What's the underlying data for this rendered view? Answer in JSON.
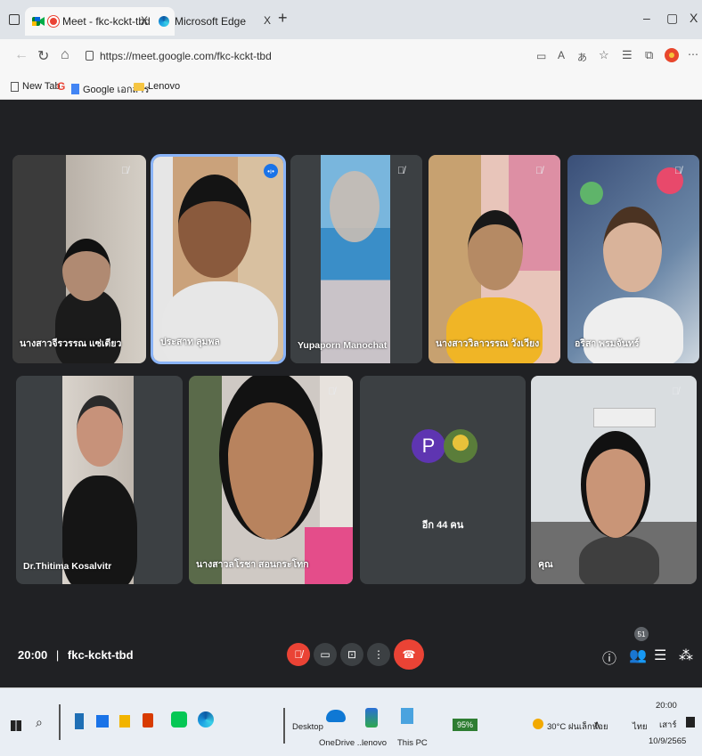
{
  "browser": {
    "tabs": [
      {
        "label": "Meet - fkc-kckt-tbd",
        "close": "X"
      },
      {
        "label": "Microsoft Edge",
        "close": "X"
      }
    ],
    "new_tab": "+",
    "url": "https://meet.google.com/fkc-kckt-tbd",
    "window_controls": {
      "minimize": "–",
      "restore": "▢",
      "close": "X"
    },
    "bookmarks": [
      "New Tab",
      "Google เอกสาร",
      "Lenovo"
    ]
  },
  "tiles": [
    {
      "name": "นางสาวจีรวรรณ แซ่เตียว",
      "muted": true
    },
    {
      "name": "ประสาท ลุมพล",
      "muted": false,
      "speaking": true
    },
    {
      "name": "Yupaporn Manochat",
      "muted": true
    },
    {
      "name": "นางสาววิลาวรรณ วังเวียง",
      "muted": true
    },
    {
      "name": "อริสา พรมจันทร์",
      "muted": true
    },
    {
      "name": "Dr.Thitima Kosalvitr",
      "muted": false
    },
    {
      "name": "นางสาวลโรชา สอนกระโทก",
      "muted": true
    },
    {
      "more_label": "อีก 44 คน",
      "avatar_letter": "P"
    },
    {
      "name": "คุณ",
      "muted": true
    }
  ],
  "bottom": {
    "time": "20:00",
    "separator": "|",
    "meeting_code": "fkc-kckt-tbd",
    "participants_count": "51"
  },
  "taskbar": {
    "search_label": "Desktop",
    "apps": [
      "OneDrive ...",
      "lenovo",
      "This PC"
    ],
    "battery": "95%",
    "weather": "30°C ฝนเล็กน้อย",
    "lang": "ไทย",
    "time": "20:00",
    "day": "เสาร์",
    "date": "10/9/2565"
  },
  "colors": {
    "meet_bg": "#202124",
    "tile_bg": "#3c4043",
    "red": "#ea4335",
    "speaking": "#8ab4f8",
    "avatar_purple": "#5e35b1"
  }
}
